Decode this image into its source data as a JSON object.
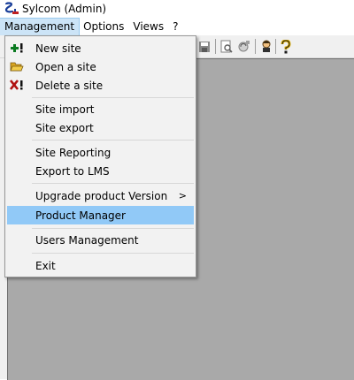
{
  "window": {
    "title": "Sylcom (Admin)",
    "icon": "sylcom-logo-icon"
  },
  "menubar": {
    "items": [
      {
        "label": "Management",
        "active": true
      },
      {
        "label": "Options"
      },
      {
        "label": "Views"
      },
      {
        "label": "?"
      }
    ]
  },
  "toolbar": {
    "icons": [
      "save-icon",
      "print-preview-icon",
      "recycle-icon",
      "user-icon",
      "help-icon"
    ]
  },
  "dropdown": {
    "items": [
      {
        "label": "New site",
        "icon": "plus-icon"
      },
      {
        "label": "Open a site",
        "icon": "folder-open-icon"
      },
      {
        "label": "Delete a site",
        "icon": "delete-icon"
      },
      {
        "label": "Site import"
      },
      {
        "label": "Site export"
      },
      {
        "label": "Site Reporting"
      },
      {
        "label": "Export to LMS"
      },
      {
        "label": "Upgrade product Version",
        "submenu_arrow": ">"
      },
      {
        "label": "Product Manager",
        "highlighted": true
      },
      {
        "label": "Users Management"
      },
      {
        "label": "Exit"
      }
    ]
  },
  "colors": {
    "highlight": "#91c9f7",
    "canvas": "#a9a9a9",
    "menu_bg": "#f2f2f2",
    "menubar_active": "#cce4f7"
  }
}
